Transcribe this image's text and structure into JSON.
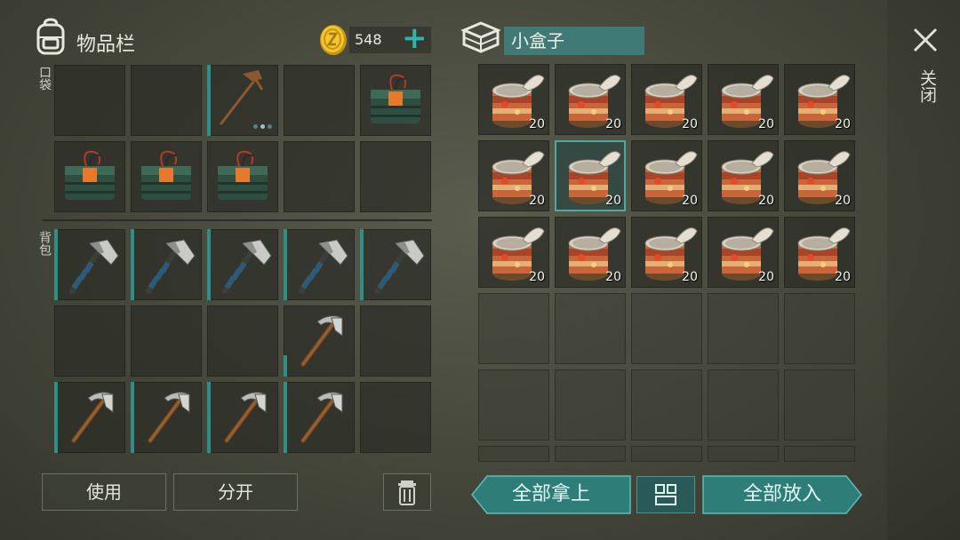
{
  "left_panel": {
    "title": "物品栏",
    "coins": "548",
    "pocket_label": "口袋",
    "backpack_label": "背包",
    "buttons": {
      "use": "使用",
      "split": "分开"
    }
  },
  "right_panel": {
    "container_name": "小盒子",
    "close_label": "关闭",
    "buttons": {
      "take_all": "全部拿上",
      "put_all": "全部放入"
    },
    "can_count": "20"
  },
  "colors": {
    "accent": "#2fb3ad",
    "teal_button": "#2f7d79",
    "durability": "#2c8f8a"
  },
  "icons": [
    "backpack-icon",
    "coin-icon",
    "plus-icon",
    "box-icon",
    "close-icon",
    "trash-icon",
    "sort-icon"
  ]
}
